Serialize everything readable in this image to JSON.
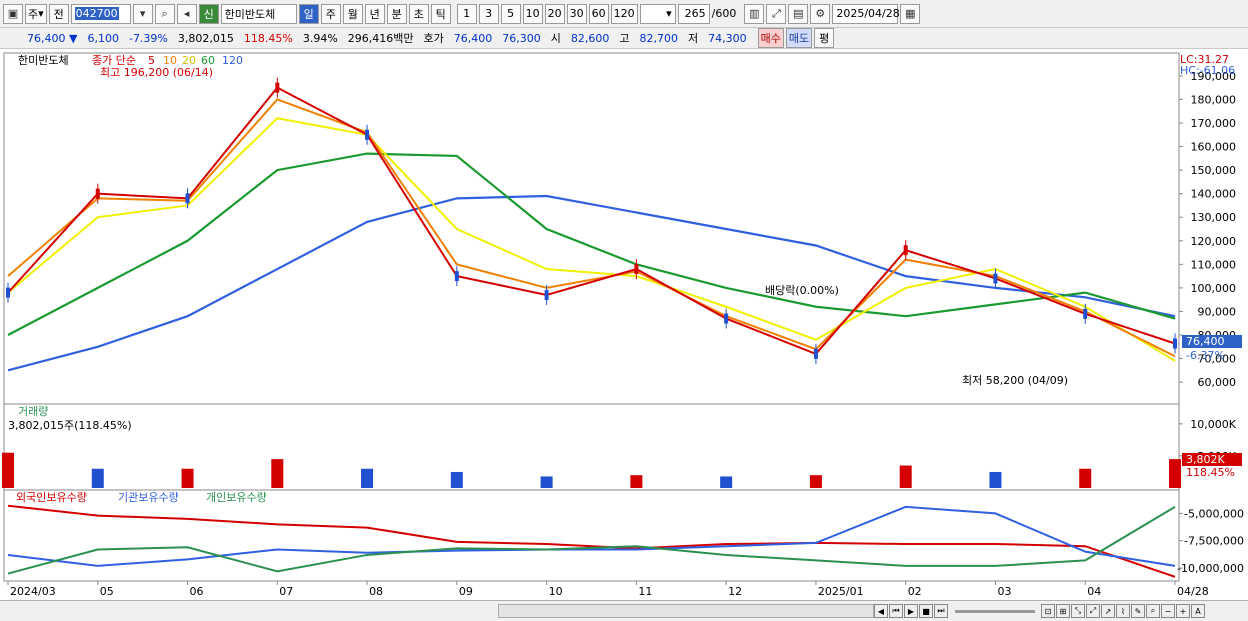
{
  "toolbar": {
    "period_label": "주",
    "prev_label": "전",
    "code": "042700",
    "stock_name": "한미반도체",
    "credit_badge": "신",
    "tabs": [
      "일",
      "주",
      "월",
      "년",
      "분",
      "초",
      "틱"
    ],
    "active_tab": "일",
    "minutes": [
      "1",
      "3",
      "5",
      "10",
      "20",
      "30",
      "60",
      "120"
    ],
    "count": "265",
    "count_total": "/600",
    "date": "2025/04/28"
  },
  "quote": {
    "price": "76,400",
    "arrow": "▼",
    "change": "6,100",
    "change_pct": "-7.39%",
    "volume": "3,802,015",
    "vol_ratio": "118.45%",
    "turnover": "3.94%",
    "amount": "296,416백만",
    "hoga_label": "호가",
    "ask": "76,400",
    "bid": "76,300",
    "open_label": "시",
    "open": "82,600",
    "high_label": "고",
    "high": "82,700",
    "low_label": "저",
    "low": "74,300",
    "buy_label": "매수",
    "sell_label": "매도",
    "eval_label": "평"
  },
  "price_panel": {
    "legend_name": "한미반도체",
    "legend_ma": "종가 단순",
    "ma_periods": [
      "5",
      "10",
      "20",
      "60",
      "120"
    ],
    "ma_colors": [
      "#d40000",
      "#f08000",
      "#f0f000",
      "#1a9a30",
      "#3060e0"
    ],
    "high_note": "최고 196,200 (06/14)",
    "low_note": "최저 58,200 (04/09)",
    "dividend_note": "배당락(0.00%)",
    "lc": "LC:31.27",
    "hc": "HC:-61.06",
    "price_tag": "76,400",
    "pct_tag": "-6.37%",
    "yticks": [
      "190,000",
      "180,000",
      "170,000",
      "160,000",
      "150,000",
      "140,000",
      "130,000",
      "120,000",
      "110,000",
      "100,000",
      "90,000",
      "80,000",
      "70,000",
      "60,000"
    ]
  },
  "volume_panel": {
    "title": "거래량",
    "value_note": "3,802,015주(118.45%)",
    "yticks": [
      "10,000K",
      "5,000K"
    ],
    "tag": "3,802K",
    "tag2": "118.45%"
  },
  "holder_panel": {
    "legend": [
      "외국인보유수량",
      "기관보유수량",
      "개인보유수량"
    ],
    "colors": [
      "#d40000",
      "#3060e0",
      "#2a9050"
    ],
    "yticks": [
      "-5,000,000",
      "-7,500,000",
      "-10,000,000"
    ]
  },
  "xaxis": [
    "2024/03",
    "05",
    "06",
    "07",
    "08",
    "09",
    "10",
    "11",
    "12",
    "2025/01",
    "02",
    "03",
    "04",
    "04/28"
  ],
  "chart_data": [
    {
      "type": "line",
      "title": "한미반도체",
      "xlabel": "",
      "ylabel": "",
      "ylim": [
        52000,
        198000
      ],
      "x": [
        "2024/03",
        "2024/04",
        "2024/05",
        "2024/06",
        "2024/07",
        "2024/08",
        "2024/09",
        "2024/10",
        "2024/11",
        "2024/12",
        "2025/01",
        "2025/02",
        "2025/03",
        "2025/04"
      ],
      "series": [
        {
          "name": "5",
          "values": [
            98000,
            140000,
            138000,
            185000,
            165000,
            105000,
            97000,
            108000,
            87000,
            72000,
            116000,
            104000,
            89000,
            76400
          ]
        },
        {
          "name": "10",
          "values": [
            105000,
            138000,
            137000,
            180000,
            166000,
            110000,
            100000,
            107000,
            88000,
            74000,
            112000,
            105000,
            90000,
            71000
          ]
        },
        {
          "name": "20",
          "values": [
            98000,
            130000,
            135000,
            172000,
            165000,
            125000,
            108000,
            105000,
            92000,
            78000,
            100000,
            108000,
            92000,
            69000
          ]
        },
        {
          "name": "60",
          "values": [
            80000,
            100000,
            120000,
            150000,
            157000,
            156000,
            125000,
            110000,
            100000,
            92000,
            88000,
            93000,
            98000,
            87000
          ]
        },
        {
          "name": "120",
          "values": [
            65000,
            75000,
            88000,
            108000,
            128000,
            138000,
            139000,
            132000,
            125000,
            118000,
            105000,
            100000,
            96000,
            88000
          ]
        }
      ]
    },
    {
      "type": "bar",
      "title": "거래량",
      "xlabel": "",
      "ylabel": "",
      "x": [
        "2024/03",
        "2024/04",
        "2024/05",
        "2024/06",
        "2024/07",
        "2024/08",
        "2024/09",
        "2024/10",
        "2024/11",
        "2024/12",
        "2025/01",
        "2025/02",
        "2025/03",
        "2025/04"
      ],
      "values": [
        5500,
        3000,
        3000,
        4500,
        3000,
        2500,
        1800,
        2000,
        1800,
        2000,
        3500,
        2500,
        3000,
        4500
      ],
      "ylim": [
        0,
        12000
      ]
    },
    {
      "type": "line",
      "title": "보유수량",
      "xlabel": "",
      "ylabel": "",
      "ylim": [
        -11000000,
        -3500000
      ],
      "x": [
        "2024/03",
        "2024/04",
        "2024/05",
        "2024/06",
        "2024/07",
        "2024/08",
        "2024/09",
        "2024/10",
        "2024/11",
        "2024/12",
        "2025/01",
        "2025/02",
        "2025/03",
        "2025/04"
      ],
      "series": [
        {
          "name": "외국인보유수량",
          "values": [
            -4300000,
            -5200000,
            -5500000,
            -6000000,
            -6300000,
            -7600000,
            -7800000,
            -8200000,
            -7800000,
            -7700000,
            -7800000,
            -7800000,
            -8000000,
            -10800000
          ]
        },
        {
          "name": "기관보유수량",
          "values": [
            -8800000,
            -9800000,
            -9200000,
            -8300000,
            -8600000,
            -8400000,
            -8300000,
            -8300000,
            -8000000,
            -7700000,
            -4400000,
            -5000000,
            -8500000,
            -9800000
          ]
        },
        {
          "name": "개인보유수량",
          "values": [
            -10500000,
            -8300000,
            -8100000,
            -10300000,
            -8800000,
            -8200000,
            -8300000,
            -8000000,
            -8800000,
            -9300000,
            -9800000,
            -9800000,
            -9300000,
            -4400000
          ]
        }
      ]
    }
  ],
  "footer": {
    "controls": "⏴ ⏸ ⏹ ⏵"
  }
}
